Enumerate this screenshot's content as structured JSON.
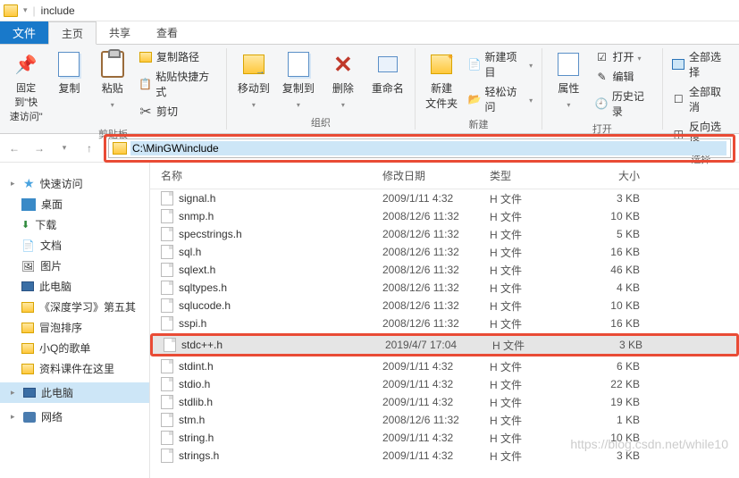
{
  "titlebar": {
    "title": "include"
  },
  "tabs": {
    "file": "文件",
    "home": "主页",
    "share": "共享",
    "view": "查看"
  },
  "ribbon": {
    "pin": "固定到\"快\n速访问\"",
    "copy": "复制",
    "paste": "粘贴",
    "copy_path": "复制路径",
    "paste_shortcut": "粘贴快捷方式",
    "cut": "剪切",
    "clipboard_group": "剪贴板",
    "move_to": "移动到",
    "copy_to": "复制到",
    "delete": "删除",
    "rename": "重命名",
    "organize_group": "组织",
    "new_folder": "新建\n文件夹",
    "new_item": "新建项目",
    "easy_access": "轻松访问",
    "new_group": "新建",
    "properties": "属性",
    "open": "打开",
    "edit": "编辑",
    "history": "历史记录",
    "open_group": "打开",
    "select_all": "全部选择",
    "select_none": "全部取消",
    "invert_sel": "反向选择",
    "select_group": "选择"
  },
  "address": {
    "path": "C:\\MinGW\\include"
  },
  "sidebar": {
    "quick": "快速访问",
    "desktop": "桌面",
    "downloads": "下载",
    "documents": "文档",
    "pictures": "图片",
    "thispc_q": "此电脑",
    "deeplearning": "《深度学习》第五其",
    "bubble": "冒泡排序",
    "songs": "小Q的歌单",
    "courseware": "资料课件在这里",
    "thispc": "此电脑",
    "network": "网络"
  },
  "columns": {
    "name": "名称",
    "date": "修改日期",
    "type": "类型",
    "size": "大小"
  },
  "files": [
    {
      "name": "signal.h",
      "date": "2009/1/11 4:32",
      "type": "H 文件",
      "size": "3 KB",
      "hl": false
    },
    {
      "name": "snmp.h",
      "date": "2008/12/6 11:32",
      "type": "H 文件",
      "size": "10 KB",
      "hl": false
    },
    {
      "name": "specstrings.h",
      "date": "2008/12/6 11:32",
      "type": "H 文件",
      "size": "5 KB",
      "hl": false
    },
    {
      "name": "sql.h",
      "date": "2008/12/6 11:32",
      "type": "H 文件",
      "size": "16 KB",
      "hl": false
    },
    {
      "name": "sqlext.h",
      "date": "2008/12/6 11:32",
      "type": "H 文件",
      "size": "46 KB",
      "hl": false
    },
    {
      "name": "sqltypes.h",
      "date": "2008/12/6 11:32",
      "type": "H 文件",
      "size": "4 KB",
      "hl": false
    },
    {
      "name": "sqlucode.h",
      "date": "2008/12/6 11:32",
      "type": "H 文件",
      "size": "10 KB",
      "hl": false
    },
    {
      "name": "sspi.h",
      "date": "2008/12/6 11:32",
      "type": "H 文件",
      "size": "16 KB",
      "hl": false
    },
    {
      "name": "stdc++.h",
      "date": "2019/4/7 17:04",
      "type": "H 文件",
      "size": "3 KB",
      "hl": true
    },
    {
      "name": "stdint.h",
      "date": "2009/1/11 4:32",
      "type": "H 文件",
      "size": "6 KB",
      "hl": false
    },
    {
      "name": "stdio.h",
      "date": "2009/1/11 4:32",
      "type": "H 文件",
      "size": "22 KB",
      "hl": false
    },
    {
      "name": "stdlib.h",
      "date": "2009/1/11 4:32",
      "type": "H 文件",
      "size": "19 KB",
      "hl": false
    },
    {
      "name": "stm.h",
      "date": "2008/12/6 11:32",
      "type": "H 文件",
      "size": "1 KB",
      "hl": false
    },
    {
      "name": "string.h",
      "date": "2009/1/11 4:32",
      "type": "H 文件",
      "size": "10 KB",
      "hl": false
    },
    {
      "name": "strings.h",
      "date": "2009/1/11 4:32",
      "type": "H 文件",
      "size": "3 KB",
      "hl": false
    }
  ],
  "watermark": "https://blog.csdn.net/while10"
}
